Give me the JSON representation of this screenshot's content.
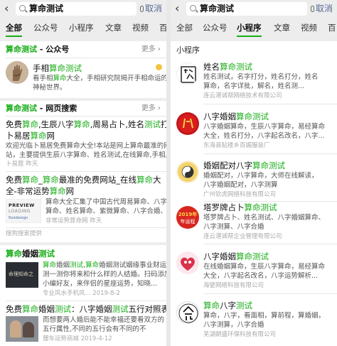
{
  "query": "算命测试",
  "cancel": "取消",
  "left": {
    "tabs": [
      "全部",
      "公众号",
      "小程序",
      "文章",
      "视频",
      "百"
    ],
    "account_section": {
      "prefix": "算命测试",
      "suffix": " - 公众号",
      "more": "更多"
    },
    "account": {
      "name_pre": "手相",
      "name_hl": "算命测试",
      "desc1_pre": "看手相",
      "desc1_hl": "算命",
      "desc1_post": "大全，手相研究院揭开手相命运的",
      "desc2": "神秘世界。"
    },
    "web_section": {
      "prefix": "算命测试",
      "suffix": " - 网页搜索",
      "more": "更多"
    },
    "web1": {
      "title_pre": "免费",
      "title_hl1": "算命",
      "title_mid1": ",生辰八字",
      "title_hl2": "算命",
      "title_mid2": ",周易占卜,姓名",
      "title_hl3": "测试",
      "title_post": "打分-",
      "title2_pre": "卜易居",
      "title2_hl": "算命",
      "title2_post": "网",
      "desc1": "欢迎光临卜易居免费算命大全!本站是网上算命最准的网",
      "desc2": "站，主要提供生辰八字算命、姓名测试,在线算命,手相,...",
      "meta": "卜易居   昨天"
    },
    "web2": {
      "l1_pre": "免费",
      "l1_hl1": "算命",
      "l1_mid": "_",
      "l1_hl2": "算命",
      "l1_post": "最准的免费网站_在线",
      "l1_hl3": "算命",
      "l1_end": "大",
      "l2_pre": "全-非常运势",
      "l2_hl": "算命",
      "l2_post": "网",
      "desc1": "算命大全汇集了中国古代周易算命、八字",
      "desc2": "算命、姓名算命、紫微算命、八字合婚、...",
      "desc3": "非常运势算命网   昨天",
      "thumb_l1": "PREVIEW",
      "thumb_l2": "LOADING",
      "thumb_l3": "fizzdesign"
    },
    "sougou": "搜狗搜索提供",
    "article1": {
      "title_hl": "算命",
      "title_post": "婚姻",
      "title_hl2": "测试",
      "desc1_hl": "算命",
      "desc1_mid": "婚姻",
      "desc1_hl2": "测试",
      "desc1_end": ",",
      "desc1_hl3": "算命",
      "desc1_post": "婚姻测试姻缘事业财运,",
      "desc2": "测一测你将来和什么样的人结婚。扫码添加",
      "desc3": "小编好友，来伴侣的星座运势，知晓...",
      "meta": "专业风水手机风...   2019-8-2",
      "thumb_text": "命理知命之"
    },
    "article2": {
      "title_pre": "免费",
      "title_hl": "算命",
      "title_mid": "婚姻",
      "title_hl2": "测试",
      "title_post": "：八字婚姻",
      "title_hl3": "测试",
      "title_end": "五行对照表",
      "desc1": "而想要两人婚后能不能幸福还要看双方的",
      "desc2": "五行属性,不同的五行会有不同的不",
      "desc3": "同来看看五行能不能婚配吧,男女...",
      "meta": "狸车运势商城   2019-4-12"
    }
  },
  "right": {
    "tabs": [
      "全部",
      "公众号",
      "小程序",
      "文章",
      "视频",
      "百"
    ],
    "section_label": "小程序",
    "items": [
      {
        "name_pre": "姓名",
        "name_hl": "算命测试",
        "name_post": "",
        "desc1": "姓名测试，名字打分，姓名打分，姓名",
        "desc2": "算命，名字详批，解名，姓名测...",
        "org": "连云港诚帮网络技术有限公司"
      },
      {
        "name_pre": "八字婚姻",
        "name_hl": "算命测试",
        "name_post": "",
        "desc1": "八字婚姻算命，生辰八字算命，易经算命",
        "desc2": "大全，姓名打分，八字起名改名，八字...",
        "org": "东海县贴楼乡百媚服装厂"
      },
      {
        "name_pre": "婚姻配对八字",
        "name_hl": "算命测试",
        "name_post": "",
        "desc1": "婚姻配对，八字算命，大师在线解读，",
        "desc2": "八字婚姻配对，八字测算",
        "org": "广州钦虎网络科技有限公司"
      },
      {
        "name_pre": "塔罗牌占卜",
        "name_hl": "算命测试",
        "name_post": "",
        "desc1": "塔罗牌占卜、姓名测试、八字婚姻算命、",
        "desc2": "八字测算、八字合婚",
        "org": "连云港诚帮企业管理有限公司",
        "badge_l1": "2019年",
        "badge_l2": "年运程"
      },
      {
        "name_pre": "八字婚姻",
        "name_hl": "算命测试",
        "name_post": "",
        "desc1": "在线婚姻算命，生辰八字算命，易经算命",
        "desc2": "大全，八字起名改名，八字运势解析...",
        "org": "海婴网络科技有限公司"
      },
      {
        "name_pre": "",
        "name_hl": "算命",
        "name_post": "八字",
        "name_hl2": "测试",
        "desc1": "算命，八字，看面相，算前程，算婚姻，",
        "desc2": "八字测算，八字合婚",
        "org": "芜湖朗盛环保科技有限公司"
      }
    ]
  }
}
